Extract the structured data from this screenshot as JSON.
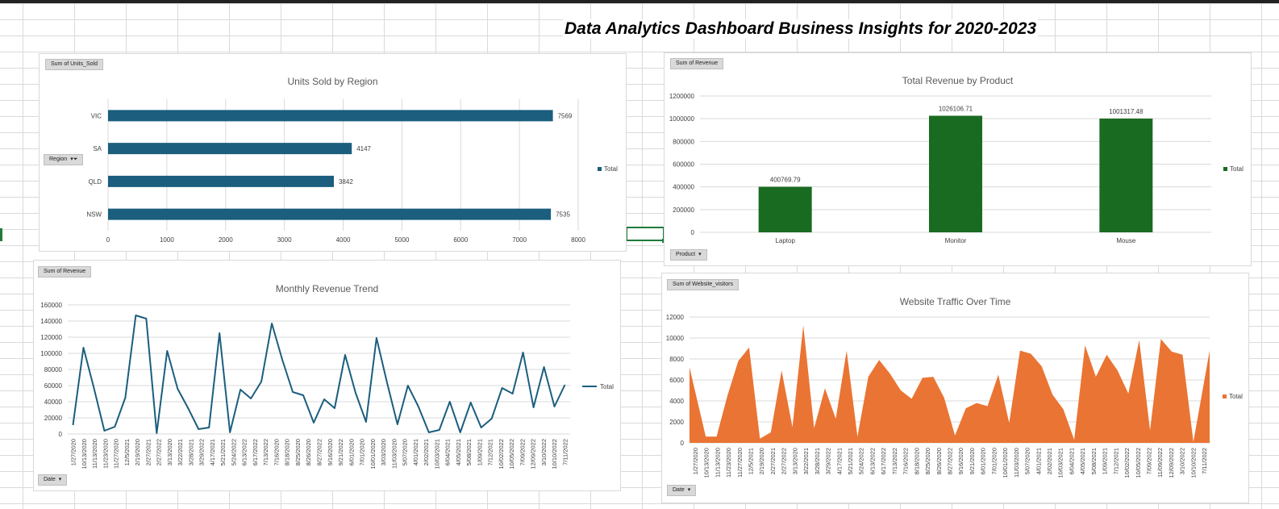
{
  "dashboard_title": "Data Analytics Dashboard Business Insights for 2020-2023",
  "chart_data": [
    {
      "type": "bar",
      "orientation": "horizontal",
      "title": "Units Sold by Region",
      "field_button": "Sum of Units_Sold",
      "axis_button": "Region",
      "categories": [
        "VIC",
        "SA",
        "QLD",
        "NSW"
      ],
      "series": [
        {
          "name": "Total",
          "values": [
            7569,
            4147,
            3842,
            7535
          ],
          "color": "#1b5e7e"
        }
      ],
      "xlim": [
        0,
        8000
      ],
      "x_ticks": [
        "0",
        "1000",
        "2000",
        "3000",
        "4000",
        "5000",
        "6000",
        "7000",
        "8000"
      ],
      "data_labels": [
        "7569",
        "4147",
        "3842",
        "7535"
      ],
      "grid": true,
      "legend_position": "right"
    },
    {
      "type": "bar",
      "title": "Total Revenue by Product",
      "field_button": "Sum of Revenue",
      "axis_button": "Product",
      "categories": [
        "Laptop",
        "Monitor",
        "Mouse"
      ],
      "series": [
        {
          "name": "Total",
          "values": [
            400769.79,
            1026106.71,
            1001317.48
          ],
          "color": "#1a6b22"
        }
      ],
      "ylim": [
        0,
        1200000
      ],
      "y_ticks": [
        "0",
        "200000",
        "400000",
        "600000",
        "800000",
        "1000000",
        "1200000"
      ],
      "data_labels": [
        "400769.79",
        "1026106.71",
        "1001317.48"
      ],
      "grid": true,
      "legend_position": "right"
    },
    {
      "type": "line",
      "title": "Monthly Revenue Trend",
      "field_button": "Sum of Revenue",
      "axis_button": "Date",
      "x": [
        "1/27/2020",
        "10/13/2020",
        "11/13/2020",
        "11/23/2020",
        "11/27/2020",
        "12/5/2021",
        "2/19/2020",
        "2/27/2021",
        "2/27/2022",
        "3/13/2020",
        "3/22/2021",
        "3/28/2021",
        "3/29/2022",
        "4/17/2021",
        "5/21/2021",
        "5/24/2022",
        "6/13/2022",
        "6/17/2022",
        "7/13/2022",
        "7/16/2020",
        "8/18/2020",
        "8/25/2020",
        "8/26/2020",
        "8/27/2022",
        "9/16/2020",
        "9/21/2022",
        "6/01/2020",
        "7/01/2020",
        "10/01/2020",
        "3/03/2020",
        "11/03/2020",
        "5/07/2020",
        "4/01/2021",
        "2/02/2021",
        "10/03/2021",
        "6/04/2021",
        "4/05/2021",
        "5/08/2021",
        "1/09/2021",
        "7/12/2021",
        "10/02/2022",
        "10/05/2022",
        "7/09/2022",
        "12/09/2022",
        "3/10/2022",
        "10/10/2022",
        "7/11/2022"
      ],
      "series": [
        {
          "name": "Total",
          "color": "#1b5e7e",
          "values": [
            11000,
            107000,
            57000,
            4000,
            9000,
            45000,
            147000,
            143000,
            1000,
            103000,
            56000,
            32000,
            6000,
            8000,
            125000,
            2000,
            55000,
            44000,
            65000,
            137000,
            92000,
            52000,
            48000,
            14000,
            43000,
            32000,
            98000,
            51000,
            15000,
            119000,
            64000,
            12000,
            60000,
            34000,
            2000,
            5000,
            40000,
            2000,
            39000,
            8000,
            19000,
            57000,
            50000,
            101000,
            33000,
            83000,
            34000,
            61000
          ]
        }
      ],
      "ylim": [
        0,
        160000
      ],
      "y_ticks": [
        "0",
        "20000",
        "40000",
        "60000",
        "80000",
        "100000",
        "120000",
        "140000",
        "160000"
      ],
      "grid": true,
      "legend_position": "right"
    },
    {
      "type": "area",
      "title": "Website Traffic Over Time",
      "field_button": "Sum of Website_visitors",
      "axis_button": "Date",
      "x": [
        "1/27/2020",
        "10/13/2020",
        "11/13/2020",
        "11/23/2020",
        "11/27/2020",
        "12/5/2021",
        "2/19/2020",
        "2/27/2021",
        "2/27/2022",
        "3/13/2020",
        "3/22/2021",
        "3/28/2021",
        "3/29/2022",
        "4/17/2021",
        "5/21/2021",
        "5/24/2022",
        "6/13/2022",
        "6/17/2022",
        "7/13/2022",
        "7/16/2022",
        "8/18/2020",
        "8/25/2020",
        "8/26/2020",
        "8/27/2022",
        "9/16/2020",
        "9/21/2020",
        "6/01/2020",
        "7/01/2020",
        "10/01/2020",
        "11/03/2020",
        "5/07/2020",
        "4/01/2021",
        "2/02/2021",
        "10/03/2021",
        "6/04/2021",
        "4/05/2021",
        "5/08/2021",
        "1/09/2021",
        "7/12/2021",
        "10/02/2022",
        "10/05/2022",
        "7/09/2022",
        "11/09/2022",
        "12/09/2022",
        "3/10/2022",
        "10/10/2022",
        "7/11/2022"
      ],
      "series": [
        {
          "name": "Total",
          "color": "#ea7433",
          "values": [
            7200,
            600,
            600,
            4500,
            7800,
            9100,
            400,
            1000,
            6900,
            1500,
            11200,
            1400,
            5200,
            2300,
            8800,
            600,
            6300,
            7900,
            6600,
            5000,
            4200,
            6200,
            6300,
            4300,
            700,
            3300,
            3800,
            3500,
            6500,
            1900,
            8800,
            8500,
            7300,
            4600,
            3200,
            300,
            9300,
            6300,
            8400,
            6900,
            4700,
            9800,
            1200,
            9900,
            8700,
            8400,
            100,
            8800
          ]
        }
      ],
      "ylim": [
        0,
        12000
      ],
      "y_ticks": [
        "0",
        "2000",
        "4000",
        "6000",
        "8000",
        "10000",
        "12000"
      ],
      "grid": true,
      "legend_position": "right"
    }
  ]
}
